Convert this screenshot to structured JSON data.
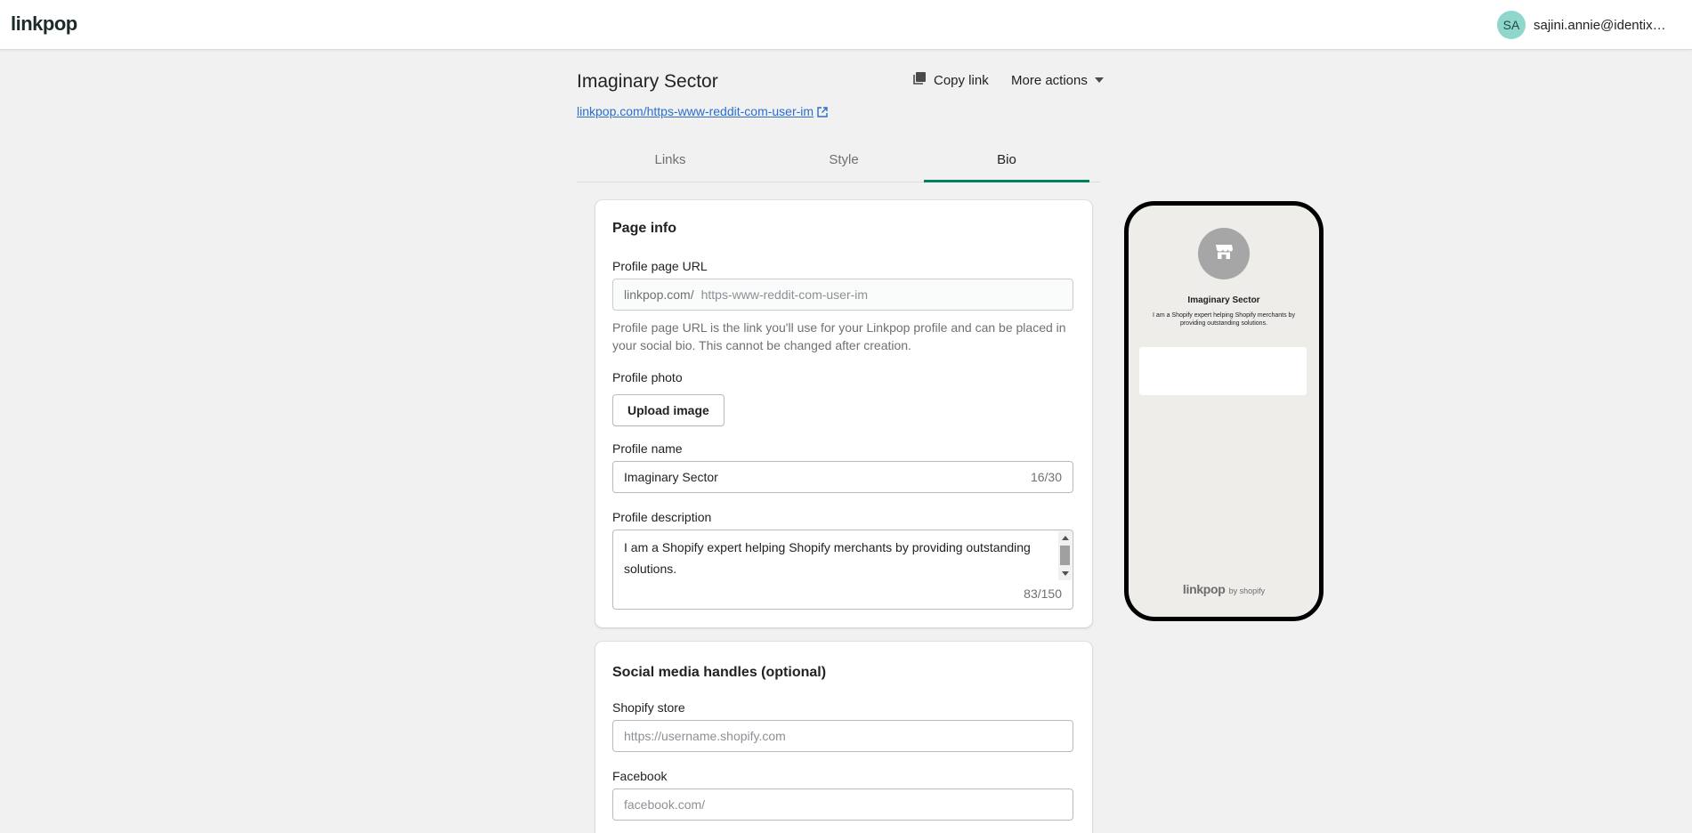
{
  "topbar": {
    "logo": "linkpop",
    "avatar_initials": "SA",
    "user_email": "sajini.annie@identixweb.com"
  },
  "header": {
    "title": "Imaginary Sector",
    "url": "linkpop.com/https-www-reddit-com-user-im",
    "copy_link_label": "Copy link",
    "more_actions_label": "More actions"
  },
  "tabs": [
    {
      "label": "Links",
      "active": false
    },
    {
      "label": "Style",
      "active": false
    },
    {
      "label": "Bio",
      "active": true
    }
  ],
  "page_info": {
    "heading": "Page info",
    "profile_url_label": "Profile page URL",
    "profile_url_prefix": "linkpop.com/",
    "profile_url_value": "https-www-reddit-com-user-im",
    "profile_url_help": "Profile page URL is the link you'll use for your Linkpop profile and can be placed in your social bio. This cannot be changed after creation.",
    "profile_photo_label": "Profile photo",
    "upload_button_label": "Upload image",
    "profile_name_label": "Profile name",
    "profile_name_value": "Imaginary Sector",
    "profile_name_counter": "16/30",
    "profile_description_label": "Profile description",
    "profile_description_value": "I am a Shopify expert helping Shopify merchants by providing outstanding solutions.",
    "profile_description_counter": "83/150"
  },
  "social": {
    "heading": "Social media handles (optional)",
    "shopify_label": "Shopify store",
    "shopify_placeholder": "https://username.shopify.com",
    "facebook_label": "Facebook",
    "facebook_prefix": "facebook.com/"
  },
  "preview": {
    "name": "Imaginary Sector",
    "description": "I am a Shopify expert helping Shopify merchants by providing outstanding solutions.",
    "footer_logo": "linkpop",
    "footer_by": "by shopify"
  },
  "colors": {
    "accent": "#008060",
    "link": "#2c6ecb",
    "avatar": "#8fd6cc",
    "page_bg": "#f1f1f1",
    "preview_bg": "#eeede9"
  },
  "icons": {
    "copy": "copy-icon",
    "external": "external-link-icon",
    "caret": "caret-down-icon",
    "store": "store-icon"
  }
}
